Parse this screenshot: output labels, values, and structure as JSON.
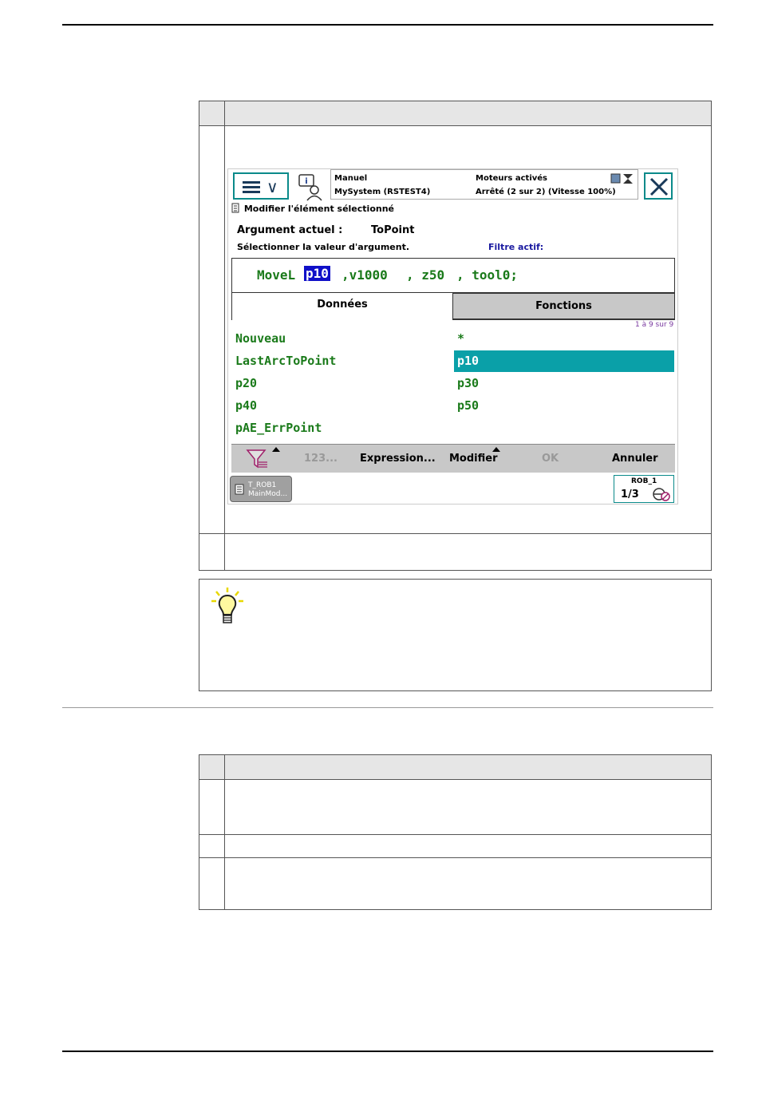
{
  "flexpendant": {
    "status": {
      "mode": "Manuel",
      "system": "MySystem (RSTEST4)",
      "motors": "Moteurs activés",
      "state": "Arrêté (2 sur 2) (Vitesse 100%)"
    },
    "breadcrumb": "Modifier l'élément sélectionné",
    "argument_label": "Argument actuel :",
    "argument_value": "ToPoint",
    "select_hint": "Sélectionner la valeur d'argument.",
    "filter_label": "Filtre actif:",
    "instruction": {
      "name": "MoveL",
      "selected_arg": "p10",
      "args": [
        ",v1000",
        ", z50",
        ", tool0;"
      ]
    },
    "tabs": {
      "data": "Données",
      "functions": "Fonctions"
    },
    "item_count": "1 à 9 sur 9",
    "items_left": [
      "Nouveau",
      "LastArcToPoint",
      "p20",
      "p40",
      "pAE_ErrPoint"
    ],
    "items_right": [
      "*",
      "p10",
      "p30",
      "p50"
    ],
    "selected_item": "p10",
    "commands": {
      "numeric": "123...",
      "expression": "Expression...",
      "modify": "Modifier",
      "ok": "OK",
      "cancel": "Annuler"
    },
    "task": {
      "line1": "T_ROB1",
      "line2": "MainMod..."
    },
    "robot": {
      "name": "ROB_1",
      "ratio": "1/3"
    }
  },
  "colors": {
    "accent": "#0a8a8a",
    "selection": "#0aa0a8",
    "code_green": "#1a7a1a",
    "code_selected": "#1010c8",
    "filter_blue": "#1a1aa0"
  }
}
